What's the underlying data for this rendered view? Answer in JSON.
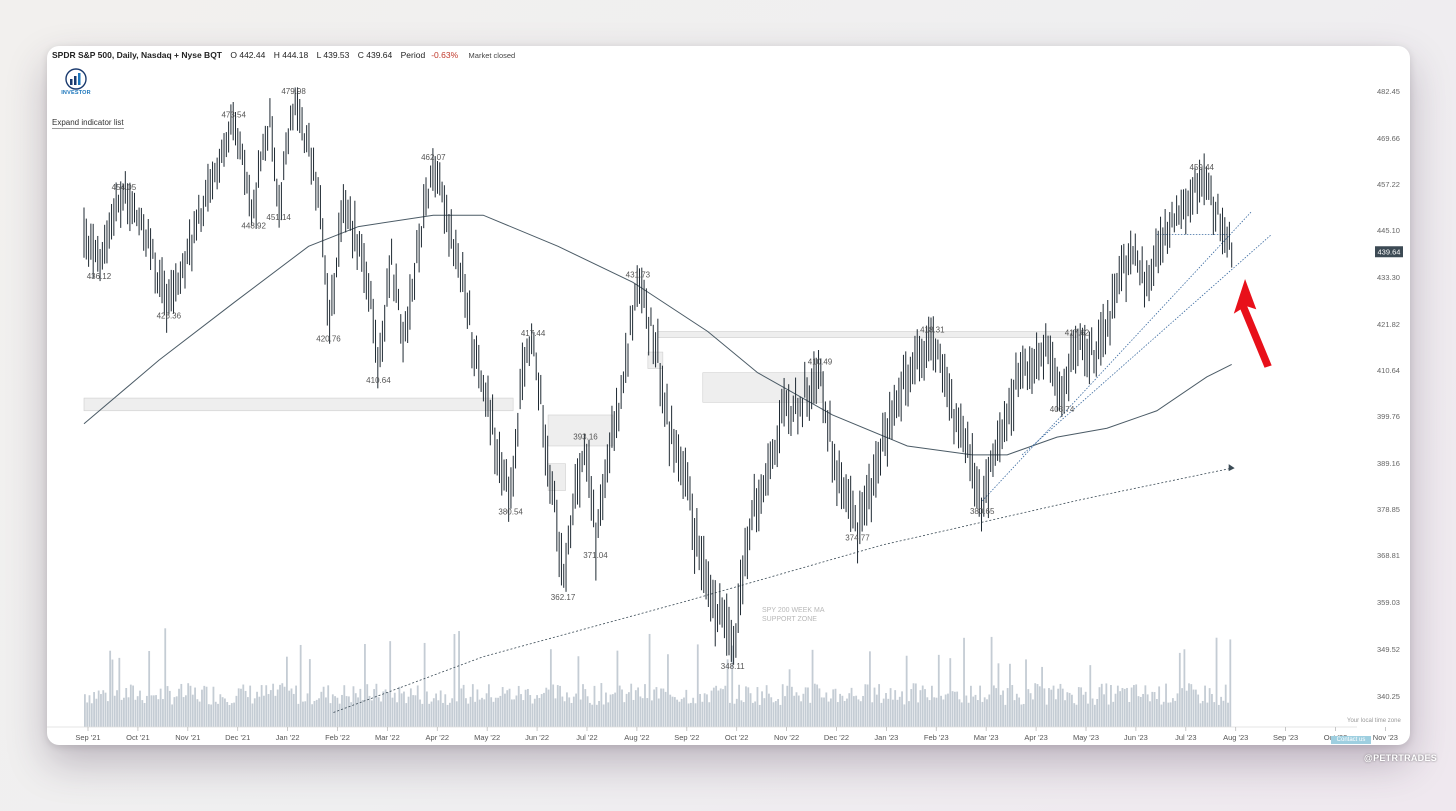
{
  "header": {
    "symbol": "SPDR S&P 500, Daily, Nasdaq + Nyse BQT",
    "open": "O 442.44",
    "high": "H 444.18",
    "low": "L 439.53",
    "close": "C 439.64",
    "period": "Period",
    "period_change": "-0.63%",
    "market_status": "Market closed"
  },
  "logo_text": "INVESTOR",
  "expand_label": "Expand indicator list",
  "local_tz_label": "Your local time zone",
  "contact_label": "Contact us",
  "watermark": "@PETRTRADES",
  "annotation": "SPY 200 WEEK MA\nSUPPORT ZONE",
  "chart_data": {
    "type": "ohlc",
    "ylim": [
      337,
      485
    ],
    "y_ticks": [
      482.45,
      469.66,
      457.22,
      445.1,
      433.3,
      421.82,
      410.64,
      399.76,
      389.16,
      378.85,
      368.81,
      359.03,
      349.52,
      340.25
    ],
    "current_price_label": "439.64",
    "x_ticks": [
      "Sep '21",
      "Oct '21",
      "Nov '21",
      "Dec '21",
      "Jan '22",
      "Feb '22",
      "Mar '22",
      "Apr '22",
      "May '22",
      "Jun '22",
      "Jul '22",
      "Aug '22",
      "Sep '22",
      "Oct '22",
      "Nov '22",
      "Dec '22",
      "Jan '23",
      "Feb '23",
      "Mar '23",
      "Apr '23",
      "May '23",
      "Jun '23",
      "Jul '23",
      "Aug '23",
      "Sep '23",
      "Oct '23",
      "Nov '23"
    ],
    "price_path": [
      {
        "month": 0.0,
        "price": 443
      },
      {
        "month": 0.3,
        "price": 436.12
      },
      {
        "month": 0.6,
        "price": 449
      },
      {
        "month": 0.8,
        "price": 454.05
      },
      {
        "month": 1.3,
        "price": 443
      },
      {
        "month": 1.5,
        "price": 432
      },
      {
        "month": 1.7,
        "price": 426.36
      },
      {
        "month": 2.1,
        "price": 440
      },
      {
        "month": 2.5,
        "price": 455
      },
      {
        "month": 2.8,
        "price": 466
      },
      {
        "month": 3.0,
        "price": 473.54
      },
      {
        "month": 3.2,
        "price": 462
      },
      {
        "month": 3.4,
        "price": 448.92
      },
      {
        "month": 3.6,
        "price": 468
      },
      {
        "month": 3.75,
        "price": 474
      },
      {
        "month": 3.9,
        "price": 451.14
      },
      {
        "month": 4.2,
        "price": 479.98
      },
      {
        "month": 4.6,
        "price": 462
      },
      {
        "month": 4.8,
        "price": 442
      },
      {
        "month": 4.9,
        "price": 420.76
      },
      {
        "month": 5.2,
        "price": 452
      },
      {
        "month": 5.5,
        "price": 443
      },
      {
        "month": 5.75,
        "price": 428
      },
      {
        "month": 5.9,
        "price": 410.64
      },
      {
        "month": 6.15,
        "price": 437
      },
      {
        "month": 6.4,
        "price": 418
      },
      {
        "month": 6.8,
        "price": 448
      },
      {
        "month": 7.0,
        "price": 462.07
      },
      {
        "month": 7.3,
        "price": 448
      },
      {
        "month": 7.6,
        "price": 430
      },
      {
        "month": 7.9,
        "price": 412
      },
      {
        "month": 8.15,
        "price": 398
      },
      {
        "month": 8.35,
        "price": 388
      },
      {
        "month": 8.55,
        "price": 380.54
      },
      {
        "month": 8.8,
        "price": 410
      },
      {
        "month": 9.0,
        "price": 417.44
      },
      {
        "month": 9.25,
        "price": 395
      },
      {
        "month": 9.45,
        "price": 378
      },
      {
        "month": 9.6,
        "price": 362.17
      },
      {
        "month": 9.85,
        "price": 383
      },
      {
        "month": 10.05,
        "price": 393.16
      },
      {
        "month": 10.25,
        "price": 371.04
      },
      {
        "month": 10.6,
        "price": 395
      },
      {
        "month": 10.85,
        "price": 412
      },
      {
        "month": 11.1,
        "price": 431.73
      },
      {
        "month": 11.45,
        "price": 418
      },
      {
        "month": 11.7,
        "price": 398
      },
      {
        "month": 11.95,
        "price": 390
      },
      {
        "month": 12.2,
        "price": 376
      },
      {
        "month": 12.45,
        "price": 362
      },
      {
        "month": 12.75,
        "price": 357
      },
      {
        "month": 13.0,
        "price": 348.11
      },
      {
        "month": 13.3,
        "price": 373
      },
      {
        "month": 13.6,
        "price": 383
      },
      {
        "month": 14.0,
        "price": 400
      },
      {
        "month": 14.4,
        "price": 403
      },
      {
        "month": 14.75,
        "price": 410.49
      },
      {
        "month": 15.0,
        "price": 392
      },
      {
        "month": 15.25,
        "price": 380
      },
      {
        "month": 15.5,
        "price": 374.77
      },
      {
        "month": 15.8,
        "price": 385
      },
      {
        "month": 16.2,
        "price": 400
      },
      {
        "month": 16.6,
        "price": 412
      },
      {
        "month": 17.0,
        "price": 418.31
      },
      {
        "month": 17.3,
        "price": 404
      },
      {
        "month": 17.55,
        "price": 396
      },
      {
        "month": 17.8,
        "price": 390
      },
      {
        "month": 18.0,
        "price": 380.65
      },
      {
        "month": 18.35,
        "price": 395
      },
      {
        "month": 18.8,
        "price": 410
      },
      {
        "month": 19.3,
        "price": 415
      },
      {
        "month": 19.6,
        "price": 403.74
      },
      {
        "month": 19.9,
        "price": 417.62
      },
      {
        "month": 20.3,
        "price": 415
      },
      {
        "month": 20.7,
        "price": 430
      },
      {
        "month": 21.0,
        "price": 440
      },
      {
        "month": 21.3,
        "price": 432
      },
      {
        "month": 21.6,
        "price": 441
      },
      {
        "month": 21.85,
        "price": 449
      },
      {
        "month": 22.2,
        "price": 455
      },
      {
        "month": 22.4,
        "price": 459.44
      },
      {
        "month": 22.7,
        "price": 450
      },
      {
        "month": 22.9,
        "price": 444
      },
      {
        "month": 23.0,
        "price": 439.64
      }
    ],
    "peak_trough_labels": [
      {
        "label": "436.12",
        "month": 0.3,
        "price": 436.12,
        "pos": "below"
      },
      {
        "label": "454.05",
        "month": 0.8,
        "price": 454.05,
        "pos": "above"
      },
      {
        "label": "426.36",
        "month": 1.7,
        "price": 426.36,
        "pos": "below"
      },
      {
        "label": "473.54",
        "month": 3.0,
        "price": 473.54,
        "pos": "above"
      },
      {
        "label": "448.92",
        "month": 3.4,
        "price": 448.92,
        "pos": "below"
      },
      {
        "label": "451.14",
        "month": 3.9,
        "price": 451.14,
        "pos": "below"
      },
      {
        "label": "479.98",
        "month": 4.2,
        "price": 479.98,
        "pos": "above"
      },
      {
        "label": "420.76",
        "month": 4.9,
        "price": 420.76,
        "pos": "below"
      },
      {
        "label": "410.64",
        "month": 5.9,
        "price": 410.64,
        "pos": "below"
      },
      {
        "label": "462.07",
        "month": 7.0,
        "price": 462.07,
        "pos": "above"
      },
      {
        "label": "380.54",
        "month": 8.55,
        "price": 380.54,
        "pos": "below"
      },
      {
        "label": "417.44",
        "month": 9.0,
        "price": 417.44,
        "pos": "above"
      },
      {
        "label": "362.17",
        "month": 9.6,
        "price": 362.17,
        "pos": "below"
      },
      {
        "label": "393.16",
        "month": 10.05,
        "price": 393.16,
        "pos": "above"
      },
      {
        "label": "371.04",
        "month": 10.25,
        "price": 371.04,
        "pos": "below"
      },
      {
        "label": "431.73",
        "month": 11.1,
        "price": 431.73,
        "pos": "above"
      },
      {
        "label": "348.11",
        "month": 13.0,
        "price": 348.11,
        "pos": "below"
      },
      {
        "label": "410.49",
        "month": 14.75,
        "price": 410.49,
        "pos": "above"
      },
      {
        "label": "374.77",
        "month": 15.5,
        "price": 374.77,
        "pos": "below"
      },
      {
        "label": "418.31",
        "month": 17.0,
        "price": 418.31,
        "pos": "above"
      },
      {
        "label": "380.65",
        "month": 18.0,
        "price": 380.65,
        "pos": "below"
      },
      {
        "label": "403.74",
        "month": 19.6,
        "price": 403.74,
        "pos": "below"
      },
      {
        "label": "417.62",
        "month": 19.9,
        "price": 417.62,
        "pos": "above"
      },
      {
        "label": "459.44",
        "month": 22.4,
        "price": 459.44,
        "pos": "above"
      }
    ],
    "moving_average_path": [
      {
        "month": 0.0,
        "price": 398
      },
      {
        "month": 1.5,
        "price": 413
      },
      {
        "month": 3.0,
        "price": 427
      },
      {
        "month": 4.5,
        "price": 441
      },
      {
        "month": 5.5,
        "price": 446
      },
      {
        "month": 7.0,
        "price": 449
      },
      {
        "month": 8.0,
        "price": 449
      },
      {
        "month": 9.5,
        "price": 441
      },
      {
        "month": 11.0,
        "price": 432
      },
      {
        "month": 12.5,
        "price": 420
      },
      {
        "month": 13.5,
        "price": 410
      },
      {
        "month": 15.0,
        "price": 400
      },
      {
        "month": 16.5,
        "price": 393
      },
      {
        "month": 17.8,
        "price": 391
      },
      {
        "month": 18.5,
        "price": 391
      },
      {
        "month": 19.5,
        "price": 395
      },
      {
        "month": 20.5,
        "price": 397
      },
      {
        "month": 21.5,
        "price": 401
      },
      {
        "month": 22.5,
        "price": 409
      },
      {
        "month": 23.0,
        "price": 412
      }
    ],
    "sma200w_dotted": [
      {
        "month": 5.0,
        "price": 337
      },
      {
        "month": 8.0,
        "price": 348
      },
      {
        "month": 12.0,
        "price": 359
      },
      {
        "month": 16.0,
        "price": 371
      },
      {
        "month": 20.0,
        "price": 381
      },
      {
        "month": 23.0,
        "price": 388
      }
    ],
    "trendlines": [
      {
        "from": {
          "month": 18.0,
          "price": 380.65
        },
        "to": {
          "month": 23.4,
          "price": 450
        }
      },
      {
        "from": {
          "month": 18.8,
          "price": 391
        },
        "to": {
          "month": 23.8,
          "price": 444
        }
      },
      {
        "from": {
          "month": 21.5,
          "price": 444
        },
        "to": {
          "month": 23.0,
          "price": 444
        }
      }
    ],
    "shaded_zones": [
      {
        "x0": 0.0,
        "x1": 8.6,
        "y0": 401,
        "y1": 404
      },
      {
        "x0": 9.3,
        "x1": 10.6,
        "y0": 393,
        "y1": 400
      },
      {
        "x0": 9.3,
        "x1": 9.65,
        "y0": 383,
        "y1": 389
      },
      {
        "x0": 11.5,
        "x1": 19.9,
        "y0": 418.5,
        "y1": 420
      },
      {
        "x0": 11.3,
        "x1": 11.6,
        "y0": 411,
        "y1": 415
      },
      {
        "x0": 12.4,
        "x1": 14.8,
        "y0": 403,
        "y1": 410
      }
    ]
  }
}
